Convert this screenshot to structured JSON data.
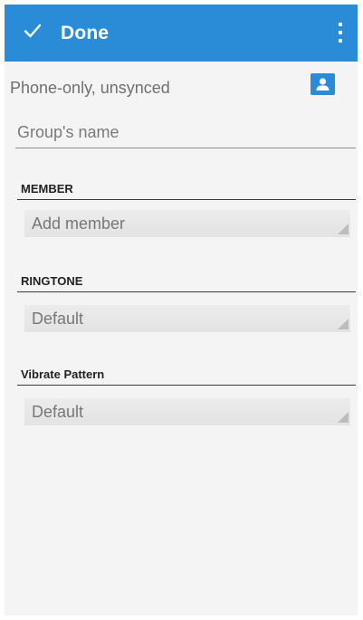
{
  "action_bar": {
    "done_label": "Done",
    "background_color": "#2a8bd7",
    "check_icon": "check-icon",
    "menu_icon": "overflow-menu-icon"
  },
  "account": {
    "label": "Phone-only, unsynced",
    "icon": "contact-card-icon"
  },
  "group_name": {
    "placeholder": "Group's name",
    "value": ""
  },
  "sections": {
    "member": {
      "header": "MEMBER",
      "field_text": "Add member"
    },
    "ringtone": {
      "header": "RINGTONE",
      "field_text": "Default"
    },
    "vibrate": {
      "header": "Vibrate Pattern",
      "field_text": "Default"
    }
  }
}
